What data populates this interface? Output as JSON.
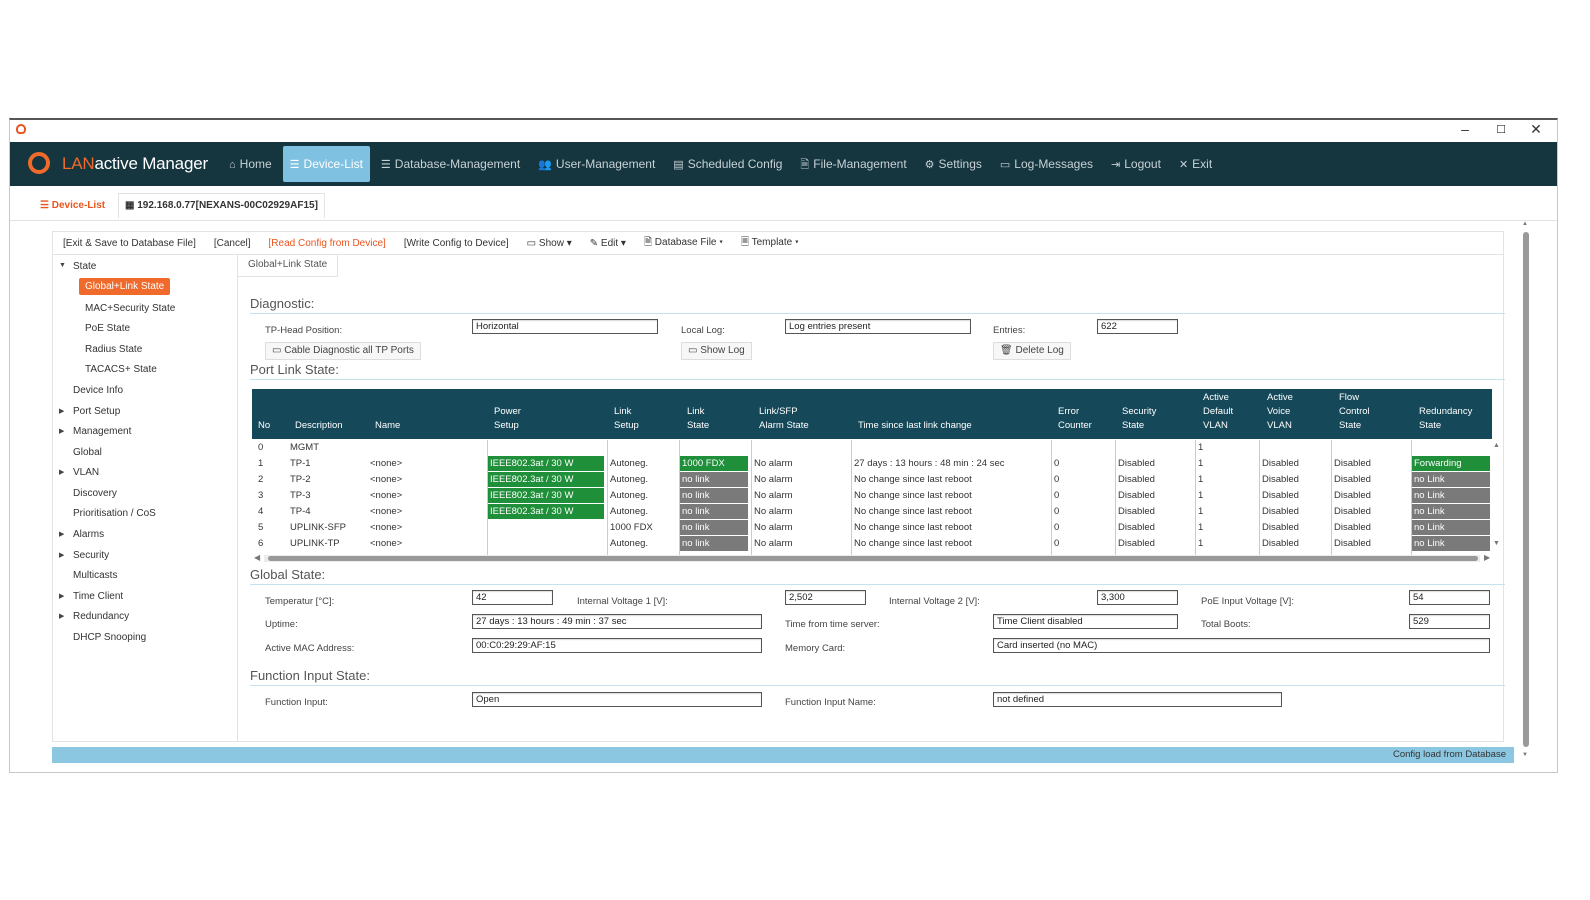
{
  "window": {
    "minimize": "–",
    "maximize": "☐",
    "close": "✕"
  },
  "brand": {
    "lan": "LAN",
    "rest": "active Manager"
  },
  "nav": [
    {
      "icon": "⌂",
      "label": "Home",
      "active": false
    },
    {
      "icon": "☰",
      "label": "Device-List",
      "active": true
    },
    {
      "icon": "☰",
      "label": "Database-Management",
      "active": false
    },
    {
      "icon": "👥",
      "label": "User-Management",
      "active": false
    },
    {
      "icon": "▤",
      "label": "Scheduled Config",
      "active": false
    },
    {
      "icon": "🗎",
      "label": "File-Management",
      "active": false
    },
    {
      "icon": "⚙",
      "label": "Settings",
      "active": false
    },
    {
      "icon": "▭",
      "label": "Log-Messages",
      "active": false
    },
    {
      "icon": "⇥",
      "label": "Logout",
      "active": false
    },
    {
      "icon": "✕",
      "label": "Exit",
      "active": false
    }
  ],
  "tabs": {
    "device_list": "Device-List",
    "device": "192.168.0.77[NEXANS-00C02929AF15]"
  },
  "toolbar": {
    "exit_save": "[Exit & Save to Database File]",
    "cancel": "[Cancel]",
    "read_config": "[Read Config from Device]",
    "write_config": "[Write Config to Device]",
    "show": "Show",
    "edit": "Edit",
    "database_file": "Database File",
    "template": "Template"
  },
  "tree": {
    "state": "State",
    "global_link": "Global+Link State",
    "mac_security": "MAC+Security State",
    "poe": "PoE State",
    "radius": "Radius State",
    "tacacs": "TACACS+ State",
    "device_info": "Device Info",
    "port_setup": "Port Setup",
    "management": "Management",
    "global": "Global",
    "vlan": "VLAN",
    "discovery": "Discovery",
    "prioritisation": "Prioritisation / CoS",
    "alarms": "Alarms",
    "security": "Security",
    "multicasts": "Multicasts",
    "time_client": "Time Client",
    "redundancy": "Redundancy",
    "dhcp": "DHCP Snooping"
  },
  "breadcrumb": "Global+Link State",
  "diagnostic": {
    "title": "Diagnostic:",
    "tp_head_label": "TP-Head Position:",
    "tp_head_value": "Horizontal",
    "local_log_label": "Local Log:",
    "local_log_value": "Log entries present",
    "entries_label": "Entries:",
    "entries_value": "622",
    "cable_btn": "Cable Diagnostic all TP Ports",
    "show_log_btn": "Show Log",
    "delete_log_btn": "Delete Log"
  },
  "port_link": {
    "title": "Port Link State:",
    "headers": {
      "no": "No",
      "description": "Description",
      "name": "Name",
      "power1": "Power",
      "power2": "Setup",
      "link1": "Link",
      "link2": "Setup",
      "lstate1": "Link",
      "lstate2": "State",
      "alarm1": "Link/SFP",
      "alarm2": "Alarm State",
      "time": "Time since last link change",
      "err1": "Error",
      "err2": "Counter",
      "sec1": "Security",
      "sec2": "State",
      "avl1": "Active",
      "avl2": "Default",
      "avl3": "VLAN",
      "vvl1": "Active",
      "vvl2": "Voice",
      "vvl3": "VLAN",
      "flow1": "Flow",
      "flow2": "Control",
      "flow3": "State",
      "red1": "Redundancy",
      "red2": "State"
    },
    "rows": [
      {
        "no": "0",
        "desc": "MGMT",
        "name": "",
        "power": "",
        "lsetup": "",
        "lstate": "",
        "alarm": "",
        "time": "",
        "err": "",
        "sec": "",
        "avlan": "1",
        "vvlan": "",
        "flow": "",
        "red": "",
        "power_c": "",
        "lstate_c": "",
        "red_c": ""
      },
      {
        "no": "1",
        "desc": "TP-1",
        "name": "<none>",
        "power": "IEEE802.3at / 30 W",
        "lsetup": "Autoneg.",
        "lstate": "1000 FDX",
        "alarm": "No alarm",
        "time": "27 days : 13 hours : 48 min : 24 sec",
        "err": "0",
        "sec": "Disabled",
        "avlan": "1",
        "vvlan": "Disabled",
        "flow": "Disabled",
        "red": "Forwarding",
        "power_c": "green",
        "lstate_c": "green",
        "red_c": "green"
      },
      {
        "no": "2",
        "desc": "TP-2",
        "name": "<none>",
        "power": "IEEE802.3at / 30 W",
        "lsetup": "Autoneg.",
        "lstate": "no link",
        "alarm": "No alarm",
        "time": "No change since last reboot",
        "err": "0",
        "sec": "Disabled",
        "avlan": "1",
        "vvlan": "Disabled",
        "flow": "Disabled",
        "red": "no Link",
        "power_c": "green",
        "lstate_c": "grey",
        "red_c": "grey"
      },
      {
        "no": "3",
        "desc": "TP-3",
        "name": "<none>",
        "power": "IEEE802.3at / 30 W",
        "lsetup": "Autoneg.",
        "lstate": "no link",
        "alarm": "No alarm",
        "time": "No change since last reboot",
        "err": "0",
        "sec": "Disabled",
        "avlan": "1",
        "vvlan": "Disabled",
        "flow": "Disabled",
        "red": "no Link",
        "power_c": "green",
        "lstate_c": "grey",
        "red_c": "grey"
      },
      {
        "no": "4",
        "desc": "TP-4",
        "name": "<none>",
        "power": "IEEE802.3at / 30 W",
        "lsetup": "Autoneg.",
        "lstate": "no link",
        "alarm": "No alarm",
        "time": "No change since last reboot",
        "err": "0",
        "sec": "Disabled",
        "avlan": "1",
        "vvlan": "Disabled",
        "flow": "Disabled",
        "red": "no Link",
        "power_c": "green",
        "lstate_c": "grey",
        "red_c": "grey"
      },
      {
        "no": "5",
        "desc": "UPLINK-SFP",
        "name": "<none>",
        "power": "",
        "lsetup": "1000 FDX",
        "lstate": "no link",
        "alarm": "No alarm",
        "time": "No change since last reboot",
        "err": "0",
        "sec": "Disabled",
        "avlan": "1",
        "vvlan": "Disabled",
        "flow": "Disabled",
        "red": "no Link",
        "power_c": "",
        "lstate_c": "grey",
        "red_c": "grey"
      },
      {
        "no": "6",
        "desc": "UPLINK-TP",
        "name": "<none>",
        "power": "",
        "lsetup": "Autoneg.",
        "lstate": "no link",
        "alarm": "No alarm",
        "time": "No change since last reboot",
        "err": "0",
        "sec": "Disabled",
        "avlan": "1",
        "vvlan": "Disabled",
        "flow": "Disabled",
        "red": "no Link",
        "power_c": "",
        "lstate_c": "grey",
        "red_c": "grey"
      }
    ]
  },
  "global_state": {
    "title": "Global State:",
    "temp_label": "Temperatur [°C]:",
    "temp_value": "42",
    "v1_label": "Internal Voltage 1 [V]:",
    "v1_value": "2,502",
    "v2_label": "Internal Voltage 2 [V]:",
    "v2_value": "3,300",
    "poe_label": "PoE Input Voltage [V]:",
    "poe_value": "54",
    "uptime_label": "Uptime:",
    "uptime_value": "27 days : 13 hours : 49 min : 37 sec",
    "timeserver_label": "Time from time server:",
    "timeserver_value": "Time Client disabled",
    "boots_label": "Total Boots:",
    "boots_value": "529",
    "mac_label": "Active MAC Address:",
    "mac_value": "00:C0:29:29:AF:15",
    "memcard_label": "Memory Card:",
    "memcard_value": "Card inserted (no MAC)"
  },
  "function_input": {
    "title": "Function Input State:",
    "fi_label": "Function Input:",
    "fi_value": "Open",
    "fin_label": "Function Input Name:",
    "fin_value": "not defined"
  },
  "status": "Config load from Database",
  "colors": {
    "navbar": "#15353f",
    "accent": "#ef6a2b",
    "active_nav": "#7fc1e0",
    "table_head": "#15495a",
    "ok_green": "#1f8f3a",
    "nolink_grey": "#7a7a7a",
    "statusbar": "#8cc7e2"
  }
}
